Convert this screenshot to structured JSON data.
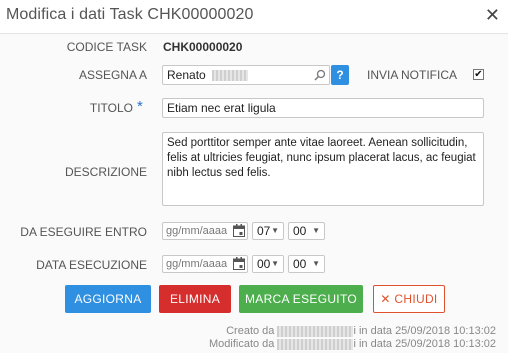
{
  "dialog": {
    "title": "Modifica i dati Task CHK00000020",
    "close_icon": "close-icon"
  },
  "form": {
    "codice_label": "CODICE TASK",
    "codice_value": "CHK00000020",
    "assegna_label": "ASSEGNA A",
    "assegna_value": "Renato",
    "search_icon": "search-icon",
    "help_button": "?",
    "notifica_label": "INVIA NOTIFICA",
    "notifica_checked": true,
    "titolo_label": "TITOLO",
    "titolo_required": "*",
    "titolo_value": "Etiam nec erat ligula",
    "descrizione_label": "DESCRIZIONE",
    "descrizione_value": "Sed porttitor semper ante vitae laoreet. Aenean sollicitudin, felis at ultricies feugiat, nunc ipsum placerat lacus, ac feugiat nibh lectus sed felis.",
    "entro_label": "DA ESEGUIRE ENTRO",
    "entro_date_placeholder": "gg/mm/aaaa",
    "entro_hour": "07",
    "entro_minute": "00",
    "esecuzione_label": "DATA ESECUZIONE",
    "esecuzione_date_placeholder": "gg/mm/aaaa",
    "esecuzione_hour": "00",
    "esecuzione_minute": "00"
  },
  "actions": {
    "aggiorna": "AGGIORNA",
    "elimina": "ELIMINA",
    "marca": "MARCA ESEGUITO",
    "chiudi": "CHIUDI"
  },
  "footer": {
    "creato_prefix": "Creato da",
    "creato_suffix": "i in data 25/09/2018 10:13:02",
    "modificato_prefix": "Modificato da",
    "modificato_suffix": "i in data 25/09/2018 10:13:02"
  },
  "colors": {
    "aggiorna": "#2f8fe0",
    "elimina": "#d62d2d",
    "marca": "#4cae4c",
    "chiudi_border": "#e0522d",
    "required": "#2e73c8"
  }
}
